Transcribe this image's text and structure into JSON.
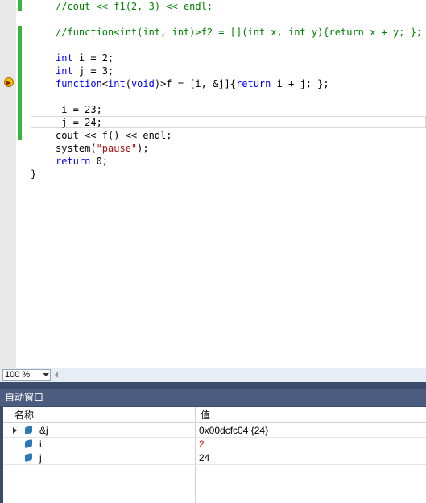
{
  "editor": {
    "lines": [
      {
        "text": "//cout << f1(2, 3) << endl;"
      },
      {
        "text": "//function<int(int, int)>f2 = [](int x, int y){return x + y; };"
      },
      {
        "kw1": "int",
        "rest": " i = 2;"
      },
      {
        "kw1": "int",
        "rest": " j = 3;"
      },
      {
        "kw1": "function",
        "mid": "<",
        "kw2": "int",
        "rest": "(",
        "kw3": "void",
        "tail": ")>f = [i, &j]{",
        "kw4": "return",
        "end": " i + j; };"
      },
      {
        "text": " i = 23;"
      },
      {
        "text": " j = 24;"
      },
      {
        "text": "cout << f() << endl;"
      },
      {
        "pre": "system(",
        "str": "\"pause\"",
        "post": ");"
      },
      {
        "kw1": "return",
        "rest": " 0;"
      },
      {
        "text": "}"
      }
    ]
  },
  "zoom": {
    "value": "100 %"
  },
  "autos": {
    "title": "自动窗口",
    "col_name": "名称",
    "col_value": "值",
    "rows": [
      {
        "name": "&j",
        "value": "0x00dcfc04 {24}",
        "value_color": "#000000"
      },
      {
        "name": "i",
        "value": "2",
        "value_color": "#d01010"
      },
      {
        "name": "j",
        "value": "24",
        "value_color": "#000000"
      }
    ]
  }
}
